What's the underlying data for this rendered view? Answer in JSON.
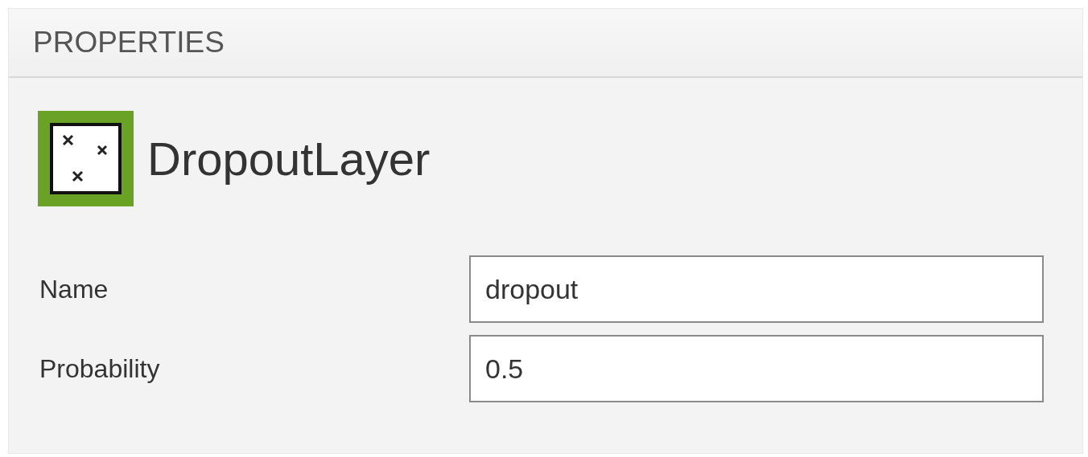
{
  "panel": {
    "title": "PROPERTIES"
  },
  "layer": {
    "name": "DropoutLayer"
  },
  "fields": [
    {
      "label": "Name",
      "value": "dropout"
    },
    {
      "label": "Probability",
      "value": "0.5"
    }
  ]
}
